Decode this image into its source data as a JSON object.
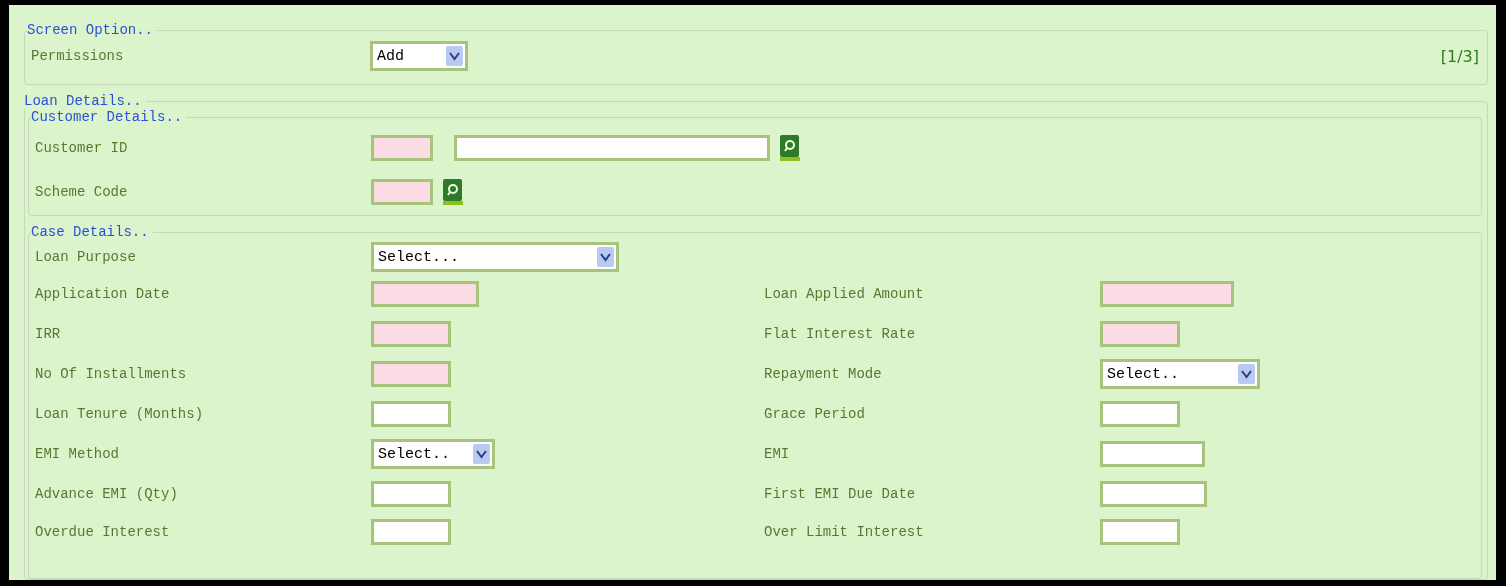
{
  "screen_option": {
    "legend": "Screen Option..",
    "permission_label": "Permissions",
    "permission_value": "Add",
    "page_indicator": "[1/3]"
  },
  "loan_details": {
    "legend": "Loan Details..",
    "customer_details": {
      "legend": "Customer Details..",
      "fields": [
        {
          "label": "Customer ID",
          "inputs": [
            {
              "required": true
            },
            {
              "required": false
            }
          ],
          "lookup": true
        },
        {
          "label": "Scheme Code",
          "inputs": [
            {
              "required": true
            }
          ],
          "lookup": true
        }
      ]
    },
    "case_details": {
      "legend": "Case Details..",
      "rows": [
        {
          "left": {
            "label": "Loan Purpose",
            "kind": "select",
            "value": "Select..."
          }
        },
        {
          "left": {
            "label": "Application Date",
            "kind": "text",
            "required": true
          },
          "right": {
            "label": "Loan Applied Amount",
            "kind": "text",
            "required": true
          }
        },
        {
          "left": {
            "label": "IRR",
            "kind": "text",
            "required": true
          },
          "right": {
            "label": "Flat Interest Rate",
            "kind": "text",
            "required": true
          }
        },
        {
          "left": {
            "label": "No Of Installments",
            "kind": "text",
            "required": true
          },
          "right": {
            "label": "Repayment Mode",
            "kind": "select",
            "value": "Select.."
          }
        },
        {
          "left": {
            "label": "Loan Tenure (Months)",
            "kind": "text",
            "required": false
          },
          "right": {
            "label": "Grace Period",
            "kind": "text",
            "required": false
          }
        },
        {
          "left": {
            "label": "EMI Method",
            "kind": "select",
            "value": "Select.."
          },
          "right": {
            "label": "EMI",
            "kind": "text",
            "required": false
          }
        },
        {
          "left": {
            "label": "Advance EMI (Qty)",
            "kind": "text",
            "required": false
          },
          "right": {
            "label": "First EMI Due Date",
            "kind": "text",
            "required": false
          }
        },
        {
          "left": {
            "label": "Overdue Interest",
            "kind": "text",
            "required": false
          },
          "right": {
            "label": "Over Limit Interest",
            "kind": "text",
            "required": false
          }
        }
      ]
    }
  }
}
